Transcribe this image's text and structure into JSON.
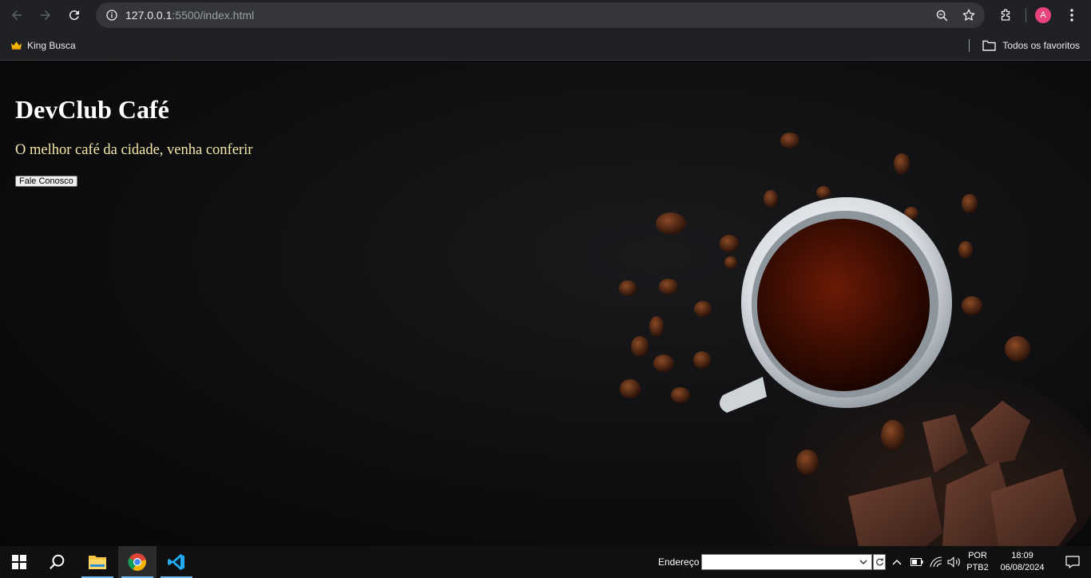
{
  "browser": {
    "url_host": "127.0.0.1",
    "url_rest": ":5500/index.html",
    "profile_initial": "A",
    "bookmarks": [
      {
        "label": "King Busca",
        "icon": "crown-icon"
      }
    ],
    "all_bookmarks_label": "Todos os favoritos"
  },
  "page": {
    "title": "DevClub Café",
    "subtitle": "O melhor café da cidade, venha conferir",
    "cta_label": "Fale Conosco"
  },
  "taskbar": {
    "address_label": "Endereço",
    "address_value": "",
    "language": "POR",
    "layout": "PTB2",
    "time": "18:09",
    "date": "06/08/2024"
  },
  "colors": {
    "chrome_bg": "#202124",
    "omnibox_bg": "#35363a",
    "subtitle": "#f3e7a9",
    "avatar": "#e8437c",
    "taskbar_bg": "#101010"
  }
}
